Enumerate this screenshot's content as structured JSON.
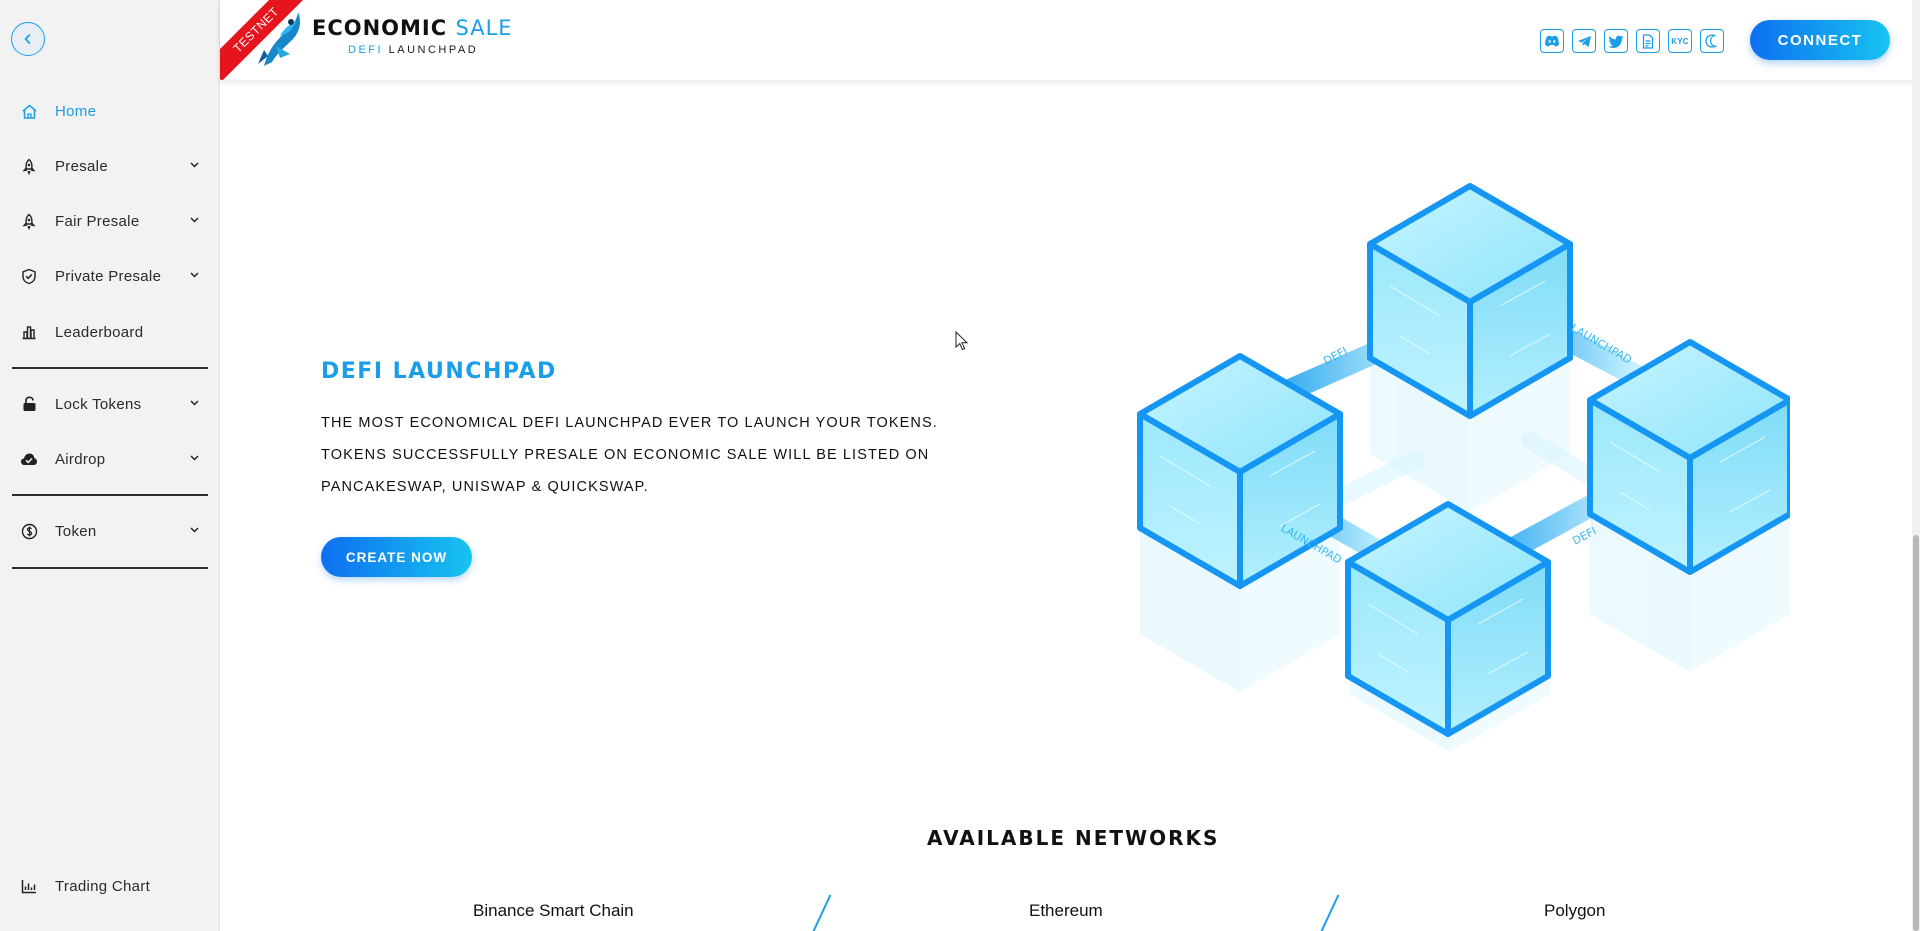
{
  "header": {
    "ribbon": "TESTNET",
    "brand_part1": "ECONOMIC",
    "brand_part2": "SALE",
    "sub_part1": "DEFI",
    "sub_part2": "LAUNCHPAD",
    "socials": [
      "discord-icon",
      "telegram-icon",
      "twitter-icon",
      "document-icon",
      "kyc-icon",
      "moon-icon"
    ],
    "kyc_label": "KYC",
    "connect_label": "CONNECT"
  },
  "sidebar": {
    "items": [
      {
        "label": "Home",
        "icon": "home-icon",
        "active": true
      },
      {
        "label": "Presale",
        "icon": "rocket-icon",
        "dropdown": true
      },
      {
        "label": "Fair Presale",
        "icon": "rocket-icon",
        "dropdown": true
      },
      {
        "label": "Private Presale",
        "icon": "shield-check-icon",
        "dropdown": true
      },
      {
        "label": "Leaderboard",
        "icon": "bar-chart-icon"
      },
      {
        "label": "Lock Tokens",
        "icon": "lock-icon",
        "dropdown": true
      },
      {
        "label": "Airdrop",
        "icon": "cloud-check-icon",
        "dropdown": true
      },
      {
        "label": "Token",
        "icon": "coin-icon",
        "dropdown": true
      },
      {
        "label": "Trading Chart",
        "icon": "chart-icon"
      }
    ]
  },
  "hero": {
    "title": "DEFI LAUNCHPAD",
    "line1": "THE MOST ECONOMICAL DEFI LAUNCHPAD EVER TO LAUNCH YOUR TOKENS.",
    "line2": "TOKENS SUCCESSFULLY PRESALE ON ECONOMIC SALE WILL BE LISTED ON",
    "line3": "PANCAKESWAP, UNISWAP & QUICKSWAP.",
    "button": "CREATE NOW"
  },
  "illustration": {
    "labels": [
      "DEFI",
      "LAUNCHPAD",
      "LAUNCHPAD",
      "DEFI"
    ]
  },
  "networks": {
    "title": "AVAILABLE NETWORKS",
    "items": [
      "Binance Smart Chain",
      "Ethereum",
      "Polygon"
    ]
  },
  "colors": {
    "accent": "#1a9ee8",
    "ribbon": "#e6141e",
    "sidebar_bg": "#f2f2f2"
  }
}
